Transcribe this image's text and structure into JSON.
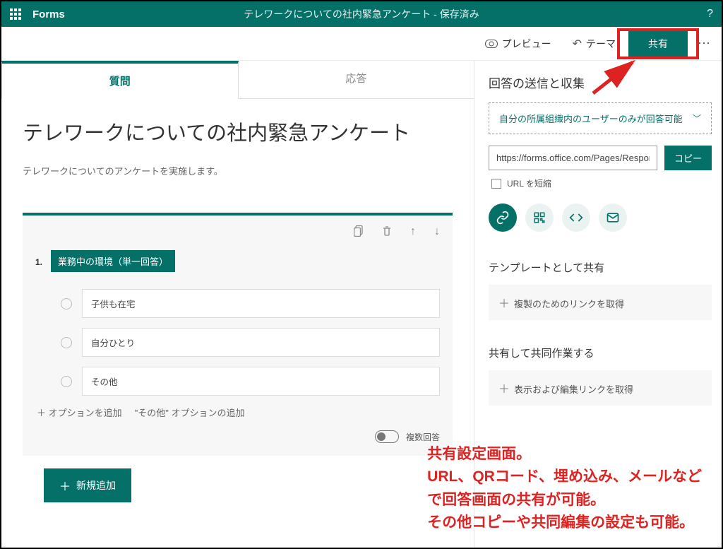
{
  "header": {
    "brand": "Forms",
    "doc_title": "テレワークについての社内緊急アンケート - 保存済み"
  },
  "commands": {
    "preview": "プレビュー",
    "theme": "テーマ",
    "share": "共有"
  },
  "tabs": {
    "questions": "質問",
    "responses": "応答"
  },
  "form": {
    "title": "テレワークについての社内緊急アンケート",
    "description": "テレワークについてのアンケートを実施します。",
    "question1": {
      "number": "1.",
      "title": "業務中の環境（単一回答）",
      "options": [
        "子供も在宅",
        "自分ひとり",
        "その他"
      ],
      "add_option": "オプションを追加",
      "add_other": "\"その他\" オプションの追加",
      "multi_answer": "複数回答"
    },
    "add_new": "新規追加"
  },
  "share_panel": {
    "title": "回答の送信と収集",
    "permission": "自分の所属組織内のユーザーのみが回答可能",
    "url_value": "https://forms.office.com/Pages/Respor",
    "copy": "コピー",
    "short_url": "URL を短縮",
    "template_title": "テンプレートとして共有",
    "template_action": "複製のためのリンクを取得",
    "collab_title": "共有して共同作業する",
    "collab_action": "表示および編集リンクを取得"
  },
  "annotation": {
    "line1": "共有設定画面。",
    "line2": "URL、QRコード、埋め込み、メールなど",
    "line3": "で回答画面の共有が可能。",
    "line4": "その他コピーや共同編集の設定も可能。"
  }
}
